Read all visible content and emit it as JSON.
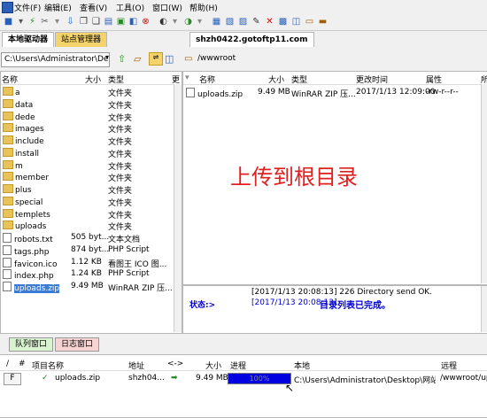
{
  "menu": [
    "文件(F)",
    "编辑(E)",
    "查看(V)",
    "工具(O)",
    "窗口(W)",
    "帮助(H)"
  ],
  "tabs": {
    "local": "本地驱动器",
    "site_manager": "站点管理器",
    "remote": "shzh0422.gotoftp11.com"
  },
  "local_path": "C:\\Users\\Administrator\\De",
  "remote_path": "/wwwroot",
  "local_columns": [
    "名称",
    "大小",
    "类型",
    "更"
  ],
  "remote_columns": [
    "名称",
    "大小",
    "类型",
    "更改时间",
    "属性",
    "所"
  ],
  "local_files": [
    {
      "name": "a",
      "size": "",
      "type": "文件夹",
      "kind": "folder"
    },
    {
      "name": "data",
      "size": "",
      "type": "文件夹",
      "kind": "folder"
    },
    {
      "name": "dede",
      "size": "",
      "type": "文件夹",
      "kind": "folder"
    },
    {
      "name": "images",
      "size": "",
      "type": "文件夹",
      "kind": "folder"
    },
    {
      "name": "include",
      "size": "",
      "type": "文件夹",
      "kind": "folder"
    },
    {
      "name": "install",
      "size": "",
      "type": "文件夹",
      "kind": "folder"
    },
    {
      "name": "m",
      "size": "",
      "type": "文件夹",
      "kind": "folder"
    },
    {
      "name": "member",
      "size": "",
      "type": "文件夹",
      "kind": "folder"
    },
    {
      "name": "plus",
      "size": "",
      "type": "文件夹",
      "kind": "folder"
    },
    {
      "name": "special",
      "size": "",
      "type": "文件夹",
      "kind": "folder"
    },
    {
      "name": "templets",
      "size": "",
      "type": "文件夹",
      "kind": "folder"
    },
    {
      "name": "uploads",
      "size": "",
      "type": "文件夹",
      "kind": "folder"
    },
    {
      "name": "robots.txt",
      "size": "505 byt...",
      "type": "文本文档",
      "kind": "file"
    },
    {
      "name": "tags.php",
      "size": "874 byt...",
      "type": "PHP Script",
      "kind": "file"
    },
    {
      "name": "favicon.ico",
      "size": "1.12 KB",
      "type": "看图王 ICO 图...",
      "kind": "file"
    },
    {
      "name": "index.php",
      "size": "1.24 KB",
      "type": "PHP Script",
      "kind": "file"
    },
    {
      "name": "uploads.zip",
      "size": "9.49 MB",
      "type": "WinRAR ZIP 压...",
      "kind": "file",
      "selected": true
    }
  ],
  "remote_files": [
    {
      "name": "uploads.zip",
      "size": "9.49 MB",
      "type": "WinRAR ZIP 压...",
      "modified": "2017/1/13 12:09:00",
      "attr": "-rw-r--r--"
    }
  ],
  "overlay_text": "上传到根目录",
  "log": {
    "line1": "[2017/1/13 20:08:13] 226 Directory send OK.",
    "label": "状态:>",
    "line2_time": "[2017/1/13 20:08:13]",
    "line2_msg": "目录列表已完成。"
  },
  "bottom_tabs": {
    "queue": "队列窗口",
    "log": "日志窗口"
  },
  "queue_columns": [
    "/",
    "#",
    "项目名称",
    "地址",
    "<->",
    "大小",
    "进程",
    "本地",
    "远程"
  ],
  "queue_row": {
    "flag": "F",
    "name": "uploads.zip",
    "address": "shzh04...",
    "size": "9.49 MB",
    "progress_text": "100%",
    "progress": 1.0,
    "local": "C:\\Users\\Administrator\\Desktop\\网站...",
    "remote": "/wwwroot/up"
  },
  "colors": {
    "accent": "#0000cc",
    "overlay": "#e02020",
    "selection": "#3a7bd5",
    "progress": "#0000e0"
  }
}
